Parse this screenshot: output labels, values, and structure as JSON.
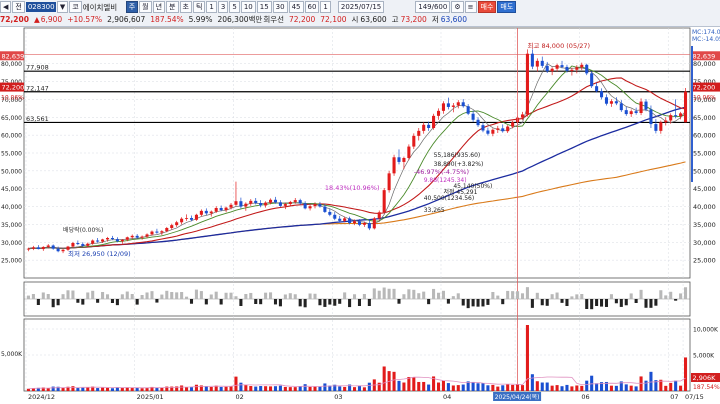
{
  "toolbar": {
    "row1": {
      "arrow_symbol": "◀",
      "name_prefix": "전",
      "code": "028300",
      "arrow2": "▼",
      "stock_label": "코",
      "stock_name": "에이치엘비",
      "period_tabs": [
        "주",
        "월",
        "년",
        "분",
        "초",
        "틱"
      ],
      "intervals": [
        "1",
        "3",
        "5",
        "10",
        "15",
        "30",
        "45",
        "60",
        "1"
      ],
      "date": "2025/07/15",
      "counter": "149/600",
      "sell_button": "매수",
      "buy_button": "매도"
    },
    "row2": {
      "price": "72,200",
      "change_sign": "▲",
      "change": "6,900",
      "change_rate": "+10.57%",
      "volume": "2,906,607",
      "volume_ratio": "187.54%",
      "turnover_ratio": "5.99%",
      "amount": "206,300백만",
      "rotation_label": "회우선",
      "current": "72,200",
      "open_label": "시",
      "open_price": "72,100",
      "open_val": "63,600",
      "high_label": "고",
      "high_val": "73,200",
      "low_label": "저",
      "low_val": "63,600"
    }
  },
  "chart_data": {
    "type": "candlestick",
    "dates": [
      "2024/12",
      "2025/01",
      "02",
      "03",
      "04",
      "2025/04/24(목)",
      "06",
      "07",
      "07/15"
    ],
    "y_ticks": [
      "80,000",
      "75,000",
      "70,000",
      "65,000",
      "60,000",
      "55,000",
      "50,000",
      "45,000",
      "40,000",
      "35,000",
      "30,000",
      "25,000"
    ],
    "ylim": [
      20000,
      90000
    ],
    "ohlc": [
      [
        28000,
        28500,
        27500,
        28200
      ],
      [
        28200,
        29000,
        27800,
        28600
      ],
      [
        28600,
        29200,
        28000,
        28100
      ],
      [
        28100,
        28900,
        27600,
        28700
      ],
      [
        28700,
        29500,
        28300,
        29100
      ],
      [
        29100,
        29400,
        27900,
        28200
      ],
      [
        28200,
        28800,
        27200,
        27500
      ],
      [
        27500,
        28200,
        26950,
        27900
      ],
      [
        27900,
        29000,
        27600,
        28800
      ],
      [
        28800,
        30100,
        28500,
        29800
      ],
      [
        29800,
        30500,
        29200,
        29500
      ],
      [
        29500,
        30000,
        28700,
        29000
      ],
      [
        29000,
        29900,
        28600,
        29600
      ],
      [
        29600,
        30800,
        29300,
        30500
      ],
      [
        30500,
        31200,
        29900,
        30200
      ],
      [
        30200,
        31000,
        29800,
        30800
      ],
      [
        30800,
        31500,
        30200,
        31200
      ],
      [
        31200,
        31800,
        30600,
        30900
      ],
      [
        30900,
        31400,
        30000,
        30300
      ],
      [
        30300,
        30900,
        29600,
        30700
      ],
      [
        30700,
        31600,
        30300,
        31400
      ],
      [
        31400,
        32200,
        31000,
        31800
      ],
      [
        31800,
        32300,
        31000,
        31300
      ],
      [
        31300,
        31900,
        30700,
        31600
      ],
      [
        31600,
        32500,
        31200,
        32200
      ],
      [
        32200,
        33300,
        31900,
        33000
      ],
      [
        33000,
        33800,
        32400,
        32700
      ],
      [
        32700,
        33400,
        32000,
        33100
      ],
      [
        33100,
        34300,
        32800,
        34000
      ],
      [
        34000,
        35200,
        33600,
        34800
      ],
      [
        34800,
        36000,
        34300,
        35600
      ],
      [
        35600,
        37000,
        35000,
        36600
      ],
      [
        36600,
        37800,
        36000,
        36800
      ],
      [
        36800,
        37500,
        35900,
        36300
      ],
      [
        36300,
        38000,
        36000,
        37700
      ],
      [
        37700,
        39200,
        37300,
        38800
      ],
      [
        38800,
        39500,
        37600,
        38100
      ],
      [
        38100,
        38900,
        37200,
        38600
      ],
      [
        38600,
        40100,
        38200,
        39600
      ],
      [
        39600,
        40300,
        38700,
        39000
      ],
      [
        39000,
        40000,
        38400,
        39700
      ],
      [
        39700,
        41000,
        39200,
        40500
      ],
      [
        40500,
        47000,
        40200,
        41500
      ],
      [
        41500,
        42500,
        39500,
        40000
      ],
      [
        40000,
        41200,
        38800,
        40800
      ],
      [
        40800,
        42100,
        40200,
        41600
      ],
      [
        41600,
        42400,
        40600,
        41000
      ],
      [
        41000,
        41800,
        39800,
        40300
      ],
      [
        40300,
        41500,
        39700,
        41100
      ],
      [
        41100,
        42300,
        40600,
        41900
      ],
      [
        41900,
        42700,
        40800,
        41200
      ],
      [
        41200,
        41800,
        39900,
        40200
      ],
      [
        40200,
        41000,
        39300,
        40700
      ],
      [
        40700,
        41600,
        40100,
        41300
      ],
      [
        41300,
        42400,
        40800,
        41800
      ],
      [
        41800,
        42200,
        40500,
        40900
      ],
      [
        40900,
        41500,
        39200,
        39500
      ],
      [
        39500,
        40500,
        38900,
        40100
      ],
      [
        40100,
        41200,
        39500,
        40700
      ],
      [
        40700,
        41300,
        39700,
        40000
      ],
      [
        40000,
        40800,
        38200,
        38500
      ],
      [
        38500,
        39400,
        37300,
        37700
      ],
      [
        37700,
        38500,
        36200,
        36600
      ],
      [
        36600,
        37400,
        35500,
        36000
      ],
      [
        36000,
        37100,
        35600,
        36700
      ],
      [
        36700,
        37200,
        35000,
        35400
      ],
      [
        35400,
        36400,
        34800,
        35900
      ],
      [
        35900,
        36500,
        34500,
        34900
      ],
      [
        34900,
        35800,
        34300,
        35400
      ],
      [
        35400,
        36400,
        33400,
        33900
      ],
      [
        33900,
        37100,
        33600,
        36700
      ],
      [
        36700,
        38900,
        36100,
        38400
      ],
      [
        38400,
        45200,
        38100,
        44600
      ],
      [
        44600,
        50000,
        43900,
        49300
      ],
      [
        49300,
        54500,
        48600,
        53800
      ],
      [
        53800,
        56000,
        51800,
        52500
      ],
      [
        52500,
        54000,
        50500,
        53600
      ],
      [
        53600,
        57400,
        53000,
        56800
      ],
      [
        56800,
        60500,
        56100,
        59800
      ],
      [
        59800,
        62000,
        58500,
        61200
      ],
      [
        61200,
        63600,
        60400,
        62900
      ],
      [
        62900,
        63800,
        61200,
        62000
      ],
      [
        62000,
        66000,
        61500,
        65400
      ],
      [
        65400,
        67500,
        64300,
        66800
      ],
      [
        66800,
        69500,
        66000,
        68900
      ],
      [
        68900,
        70500,
        67200,
        67900
      ],
      [
        67900,
        69000,
        66400,
        68300
      ],
      [
        68300,
        69800,
        67500,
        69200
      ],
      [
        69200,
        70100,
        67700,
        68100
      ],
      [
        68100,
        68700,
        65600,
        66000
      ],
      [
        66000,
        66900,
        63700,
        64300
      ],
      [
        64300,
        65000,
        62300,
        62800
      ],
      [
        62800,
        63600,
        60800,
        61300
      ],
      [
        61300,
        62100,
        59900,
        60400
      ],
      [
        60400,
        61900,
        59700,
        61500
      ],
      [
        61500,
        62600,
        60600,
        61900
      ],
      [
        61900,
        63000,
        60700,
        61100
      ],
      [
        61100,
        62800,
        60600,
        62400
      ],
      [
        62400,
        64000,
        61900,
        63600
      ],
      [
        63600,
        65400,
        63100,
        64900
      ],
      [
        64900,
        66500,
        64200,
        65800
      ],
      [
        65800,
        84000,
        65200,
        82800
      ],
      [
        82800,
        84000,
        78500,
        79200
      ],
      [
        79200,
        81500,
        77800,
        80800
      ],
      [
        80800,
        82000,
        78800,
        79400
      ],
      [
        79400,
        80500,
        77400,
        77900
      ],
      [
        77900,
        79000,
        76800,
        78600
      ],
      [
        78600,
        80000,
        77800,
        79600
      ],
      [
        79600,
        80800,
        78700,
        79100
      ],
      [
        79100,
        79700,
        77500,
        78000
      ],
      [
        78000,
        78900,
        76700,
        78300
      ],
      [
        78300,
        79600,
        77300,
        79000
      ],
      [
        79000,
        80300,
        78200,
        79700
      ],
      [
        79700,
        80000,
        76800,
        77300
      ],
      [
        77300,
        77900,
        73200,
        73700
      ],
      [
        73700,
        74700,
        71900,
        72300
      ],
      [
        72300,
        73100,
        70000,
        70600
      ],
      [
        70600,
        71400,
        68300,
        68800
      ],
      [
        68800,
        70100,
        67900,
        69500
      ],
      [
        69500,
        70600,
        68400,
        68900
      ],
      [
        68900,
        69800,
        66500,
        67000
      ],
      [
        67000,
        67900,
        65400,
        65900
      ],
      [
        65900,
        67200,
        65100,
        66700
      ],
      [
        66700,
        67700,
        65700,
        66200
      ],
      [
        66200,
        70300,
        65600,
        69400
      ],
      [
        69400,
        70100,
        66700,
        67200
      ],
      [
        67200,
        68300,
        62000,
        63100
      ],
      [
        63100,
        64500,
        60500,
        61200
      ],
      [
        61200,
        64100,
        60400,
        63600
      ],
      [
        63600,
        65000,
        62700,
        64100
      ],
      [
        64100,
        66100,
        63200,
        65600
      ],
      [
        65600,
        70000,
        64700,
        65300
      ],
      [
        65300,
        66500,
        64400,
        66100
      ],
      [
        63600,
        73200,
        63600,
        72200
      ]
    ],
    "volume_ticks": [
      "10,000K",
      "5,000K",
      "2,900K"
    ],
    "osc_ticks": [
      "5,000K"
    ],
    "ma_legend": [
      "MC:174.00",
      "MC:-14.05"
    ],
    "price_tags": {
      "close": "72,200",
      "left_close": "72,200",
      "left_top": "82,639",
      "right_top": "82,639",
      "h77908": "77,908",
      "h72147": "72,147",
      "h63561": "63,561",
      "right_pct": "10.06%",
      "left_pct": "10.06%",
      "vol_tag": "2,906K",
      "vol_pct": "187.54%"
    },
    "annotations": {
      "max": "최고 84,000 (05/27)",
      "min": "최저 26,950 (12/09)",
      "a1": "18.43%(10.96%)",
      "a2": "-46.97%(-4.75%)",
      "a3": "45,140(50%)",
      "a4": "40,500(1234.56)",
      "a5": "33,265",
      "a6": "55,186(935.60)",
      "a7": "9.88(1245.34)",
      "a8": "저점 45,291",
      "a9": "38,890(+3.82%)",
      "a10": "배당락(0.00%)"
    }
  }
}
